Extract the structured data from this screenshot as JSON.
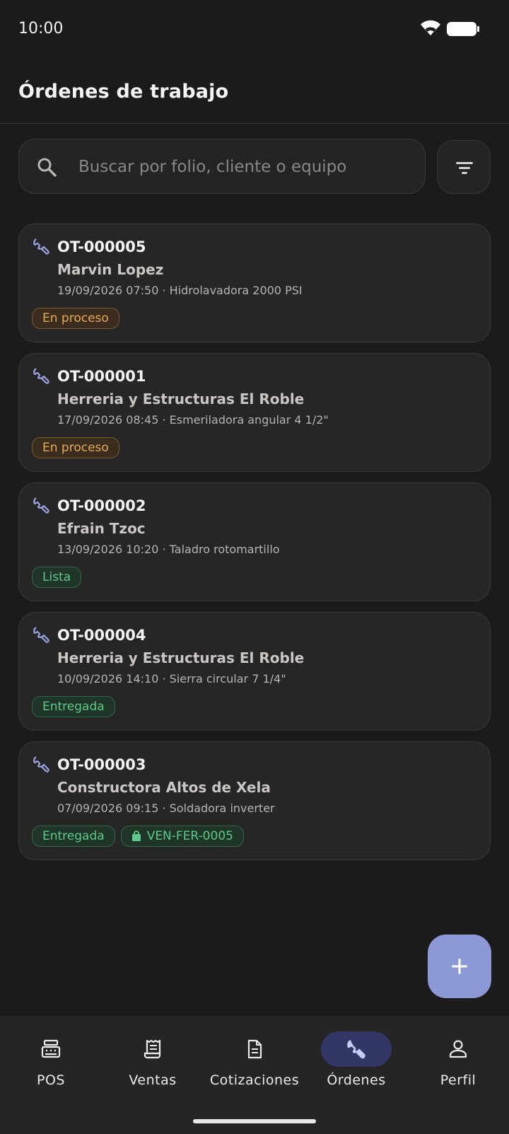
{
  "status_bar": {
    "time": "10:00"
  },
  "header": {
    "title": "Órdenes de trabajo"
  },
  "search": {
    "placeholder": "Buscar por folio, cliente o equipo",
    "value": ""
  },
  "orders": [
    {
      "folio": "OT-000005",
      "client": "Marvin Lopez",
      "meta": "19/09/2026 07:50 · Hidrolavadora 2000 PSI",
      "status": "En proceso"
    },
    {
      "folio": "OT-000001",
      "client": "Herreria y Estructuras El Roble",
      "meta": "17/09/2026 08:45 · Esmeriladora angular 4 1/2\"",
      "status": "En proceso"
    },
    {
      "folio": "OT-000002",
      "client": "Efrain Tzoc",
      "meta": "13/09/2026 10:20 · Taladro rotomartillo",
      "status": "Lista"
    },
    {
      "folio": "OT-000004",
      "client": "Herreria y Estructuras El Roble",
      "meta": "10/09/2026 14:10 · Sierra circular 7 1/4\"",
      "status": "Entregada"
    },
    {
      "folio": "OT-000003",
      "client": "Constructora Altos de Xela",
      "meta": "07/09/2026 09:15 · Soldadora inverter",
      "status": "Entregada",
      "sale": "VEN-FER-0005"
    }
  ],
  "nav": {
    "items": [
      {
        "label": "POS",
        "icon": "cash-register-icon"
      },
      {
        "label": "Ventas",
        "icon": "receipt-icon"
      },
      {
        "label": "Cotizaciones",
        "icon": "document-icon"
      },
      {
        "label": "Órdenes",
        "icon": "wrench-icon",
        "active": true
      },
      {
        "label": "Perfil",
        "icon": "person-icon"
      }
    ]
  },
  "colors": {
    "background": "#1c1b1b",
    "accent": "#8d98d6",
    "in_progress": "#e6a955",
    "done": "#5dc98a"
  }
}
